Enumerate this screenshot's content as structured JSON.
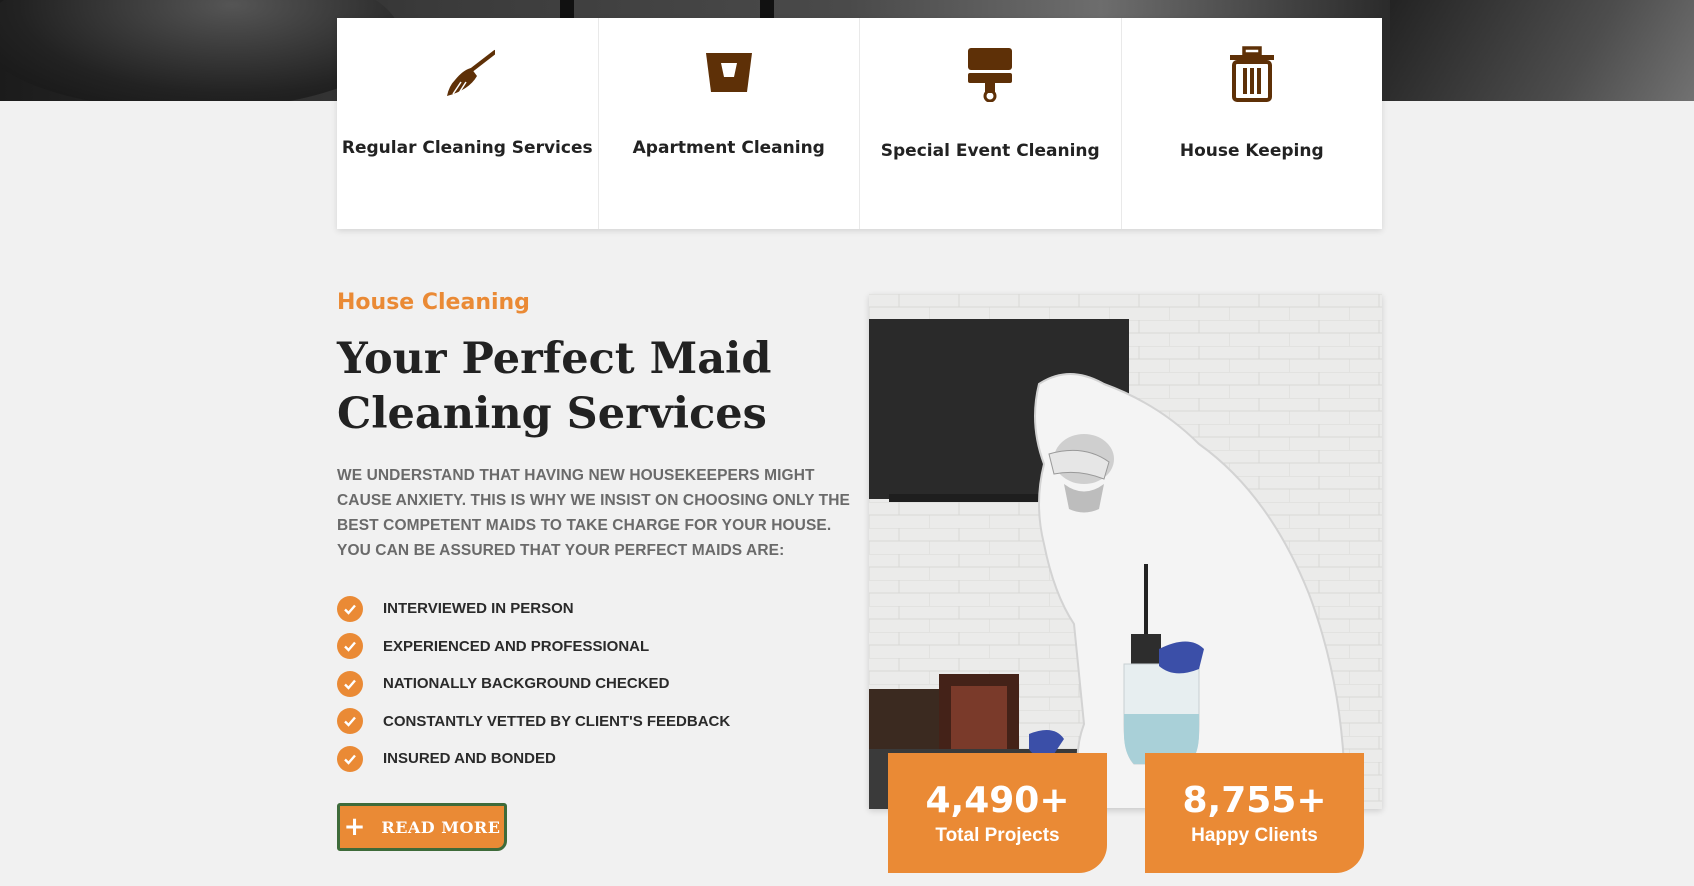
{
  "services": [
    {
      "label": "Regular Cleaning Services",
      "icon": "broom-icon"
    },
    {
      "label": "Apartment Cleaning",
      "icon": "bucket-icon"
    },
    {
      "label": "Special Event Cleaning",
      "icon": "paint-brush-icon"
    },
    {
      "label": "House Keeping",
      "icon": "trash-icon"
    }
  ],
  "about": {
    "subtitle": "House Cleaning",
    "title": "Your Perfect Maid Cleaning Services",
    "intro": "WE UNDERSTAND THAT HAVING NEW HOUSEKEEPERS MIGHT CAUSE ANXIETY. THIS IS WHY WE INSIST ON CHOOSING ONLY THE BEST COMPETENT MAIDS TO TAKE CHARGE FOR YOUR HOUSE. YOU CAN BE ASSURED THAT YOUR PERFECT MAIDS ARE:",
    "features": [
      "INTERVIEWED IN PERSON",
      "EXPERIENCED AND PROFESSIONAL",
      "NATIONALLY BACKGROUND CHECKED",
      "CONSTANTLY VETTED BY CLIENT'S FEEDBACK",
      "INSURED AND BONDED"
    ],
    "button": {
      "plus": "+",
      "label": "READ MORE"
    }
  },
  "stats": [
    {
      "value": "4,490+",
      "caption": "Total Projects"
    },
    {
      "value": "8,755+",
      "caption": "Happy Clients"
    }
  ],
  "colors": {
    "accent": "#ea8a35",
    "icon_brown": "#5e3007",
    "button_border": "#3e6b3a",
    "heading": "#222222"
  }
}
